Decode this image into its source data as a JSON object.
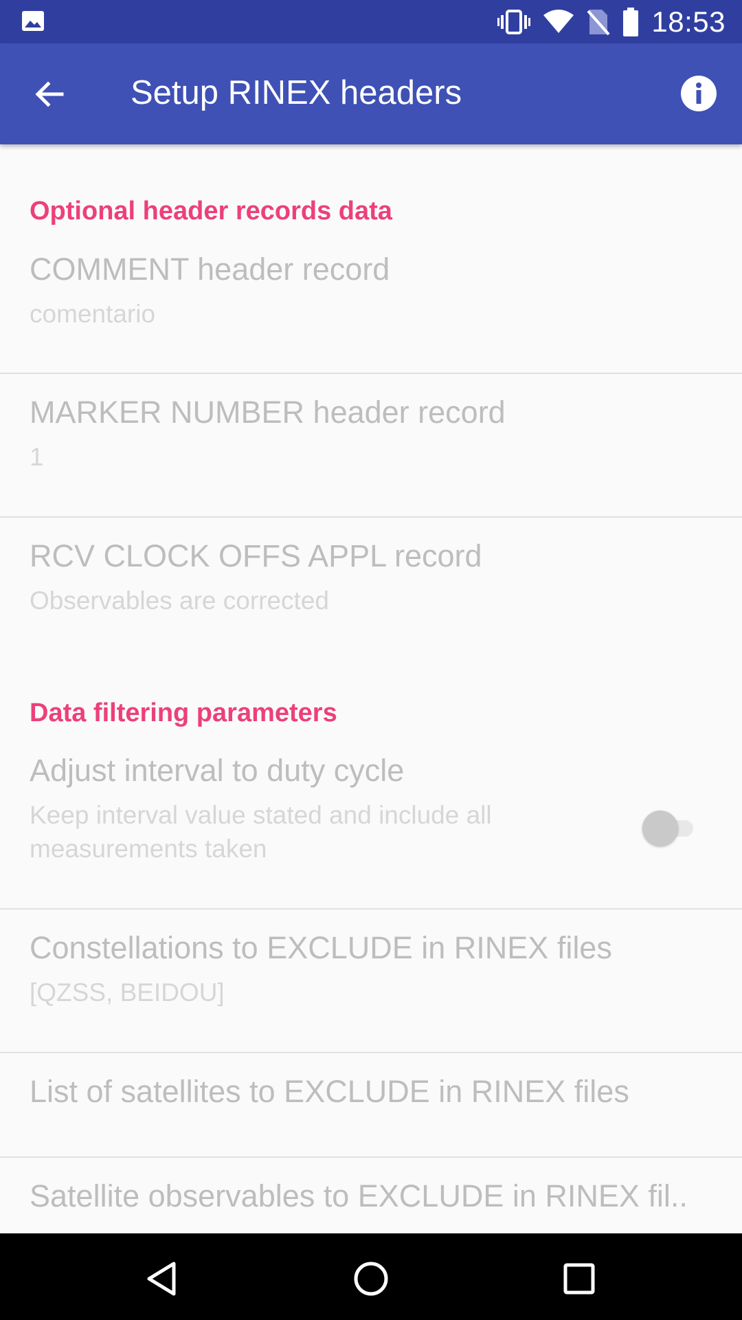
{
  "status_bar": {
    "time": "18:53",
    "icons": [
      "image-notification-icon",
      "vibrate-icon",
      "wifi-icon",
      "no-sim-icon",
      "battery-icon"
    ]
  },
  "app_bar": {
    "title": "Setup RINEX headers",
    "back_icon": "arrow-back-icon",
    "info_icon": "info-icon"
  },
  "sections": [
    {
      "category": "Optional header records data",
      "items": [
        {
          "title": "COMMENT header record",
          "summary": "comentario"
        },
        {
          "title": "MARKER NUMBER header record",
          "summary": "1"
        },
        {
          "title": "RCV CLOCK OFFS APPL record",
          "summary": "Observables are corrected"
        }
      ]
    },
    {
      "category": "Data filtering parameters",
      "items": [
        {
          "title": "Adjust interval to duty cycle",
          "summary": "Keep interval value stated and include all measurements taken",
          "switch_on": false
        },
        {
          "title": "Constellations to EXCLUDE in RINEX files",
          "summary": "[QZSS, BEIDOU]"
        },
        {
          "title": "List of satellites to EXCLUDE in RINEX files",
          "summary": ""
        },
        {
          "title": "Satellite observables to EXCLUDE in RINEX fil..",
          "summary": ""
        }
      ]
    }
  ],
  "nav_bar": {
    "buttons": [
      "back-triangle-icon",
      "home-circle-icon",
      "recents-square-icon"
    ]
  },
  "colors": {
    "status_bar": "#303f9f",
    "app_bar": "#3f51b5",
    "category_accent": "#ec407a",
    "disabled_text": "#bdbdbd"
  }
}
